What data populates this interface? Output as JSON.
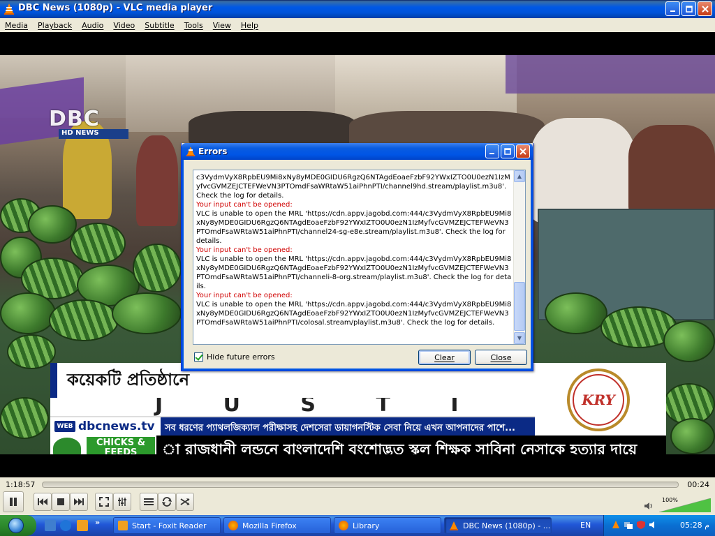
{
  "window": {
    "title": "DBC News (1080p) - VLC media player"
  },
  "menu": [
    "Media",
    "Playback",
    "Audio",
    "Video",
    "Subtitle",
    "Tools",
    "View",
    "Help"
  ],
  "video": {
    "channel_logo": "DBC",
    "channel_sublabel": "HD NEWS",
    "headline": "কয়েকটি প্রতিষ্ঠানে",
    "sub_ghost": "J U S T  I N",
    "website": "dbcnews.tv",
    "web_badge": "WEB",
    "ad_line": "সব ধরণের প্যাথলজিক্যাল পরীক্ষাসহ দেশসেরা ডায়াগনস্টিক সেবা নিয়ে এখন আপনাদের পাশে...",
    "ticker": "া রাজধানী লন্ডনে বাংলাদেশি বংশোদ্ভূত স্কুল শিক্ষক সাবিনা নেসাকে হত্যার দায়ে",
    "sponsor_name": "CHICKS & FEEDS",
    "brand_logo": "KRY"
  },
  "errors_dialog": {
    "title": "Errors",
    "lines": [
      {
        "type": "text",
        "text": "c3VydmVyX8RpbEU9Mi8xNy8yMDE0GIDU6RgzQ6NTAgdEoaeFzbF92YWxIZTO0U0ezN1IzMyfvcGVMZEJCTEFWeVN3PTOmdFsaWRtaW51aiPhnPTI/channel9hd.stream/playlist.m3u8'. Check the log for details."
      },
      {
        "type": "error",
        "text": "Your input can't be opened:"
      },
      {
        "type": "text",
        "text": "VLC is unable to open the MRL 'https://cdn.appv.jagobd.com:444/c3VydmVyX8RpbEU9Mi8xNy8yMDE0GIDU6RgzQ6NTAgdEoaeFzbF92YWxIZTO0U0ezN1IzMyfvcGVMZEJCTEFWeVN3PTOmdFsaWRtaW51aiPhnPTI/channel24-sg-e8e.stream/playlist.m3u8'. Check the log for details."
      },
      {
        "type": "error",
        "text": "Your input can't be opened:"
      },
      {
        "type": "text",
        "text": "VLC is unable to open the MRL 'https://cdn.appv.jagobd.com:444/c3VydmVyX8RpbEU9Mi8xNy8yMDE0GIDU6RgzQ6NTAgdEoaeFzbF92YWxIZTO0U0ezN1IzMyfvcGVMZEJCTEFWeVN3PTOmdFsaWRtaW51aiPhnPTI/channeli-8-org.stream/playlist.m3u8'. Check the log for details."
      },
      {
        "type": "error",
        "text": "Your input can't be opened:"
      },
      {
        "type": "text",
        "text": "VLC is unable to open the MRL 'https://cdn.appv.jagobd.com:444/c3VydmVyX8RpbEU9Mi8xNy8yMDE0GIDU6RgzQ6NTAgdEoaeFzbF92YWxIZTO0U0ezN1IzMyfvcGVMZEJCTEFWeVN3PTOmdFsaWRtaW51aiPhnPTI/colosal.stream/playlist.m3u8'. Check the log for details."
      }
    ],
    "hide_future_label": "Hide future errors",
    "hide_future_checked": true,
    "clear_label": "Clear",
    "close_label": "Close"
  },
  "controls": {
    "elapsed": "1:18:57",
    "remaining": "00:24",
    "volume": "100%",
    "volume_level": 1.0
  },
  "taskbar": {
    "tasks": [
      {
        "label": "Start - Foxit Reader",
        "icon": "foxit-icon"
      },
      {
        "label": "Mozilla Firefox",
        "icon": "firefox-icon"
      },
      {
        "label": "Library",
        "icon": "firefox-icon"
      },
      {
        "label": "DBC News (1080p) - ...",
        "icon": "vlc-icon",
        "active": true
      }
    ],
    "language": "EN",
    "clock": "05:28 م"
  },
  "colors": {
    "error_text": "#d00000",
    "xp_blue": "#0054e3",
    "dbc_blue": "#0b2a85"
  }
}
